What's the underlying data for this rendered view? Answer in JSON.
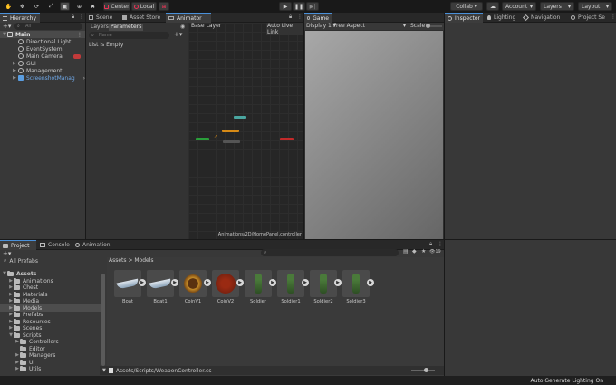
{
  "toolbar": {
    "pivot_label": "Center",
    "space_label": "Local",
    "collab_label": "Collab",
    "account_label": "Account",
    "layers_label": "Layers",
    "layout_label": "Layout"
  },
  "hierarchy": {
    "tab_label": "Hierarchy",
    "search_placeholder": "All",
    "scene_name": "Main",
    "items": [
      {
        "label": "Directional Light"
      },
      {
        "label": "EventSystem"
      },
      {
        "label": "Main Camera"
      },
      {
        "label": "GUI"
      },
      {
        "label": "Management"
      },
      {
        "label": "ScreenshotManag"
      }
    ]
  },
  "scene_tabs": {
    "scene": "Scene",
    "asset_store": "Asset Store",
    "animator": "Animator"
  },
  "animator": {
    "layers_tab": "Layers",
    "parameters_tab": "Parameters",
    "search_placeholder": "Name",
    "list_empty": "List is Empty",
    "base_layer": "Base Layer",
    "auto_live_link": "Auto Live Link",
    "footer_path": "Animations/2D/HomePanel.controller"
  },
  "game": {
    "tab_label": "Game",
    "display": "Display 1",
    "aspect": "Free Aspect",
    "scale_label": "Scale"
  },
  "inspector": {
    "tabs": [
      "Inspector",
      "Lighting",
      "Navigation",
      "Project Se"
    ]
  },
  "bottom_tabs": {
    "project": "Project",
    "console": "Console",
    "animation": "Animation"
  },
  "project": {
    "favorites": "All Prefabs",
    "root": "Assets",
    "folders": [
      {
        "label": "Animations"
      },
      {
        "label": "Chest"
      },
      {
        "label": "Materials"
      },
      {
        "label": "Media"
      },
      {
        "label": "Models"
      },
      {
        "label": "Prefabs"
      },
      {
        "label": "Resources"
      },
      {
        "label": "Scenes"
      },
      {
        "label": "Scripts"
      },
      {
        "label": "Controllers"
      },
      {
        "label": "Editor"
      },
      {
        "label": "Managers"
      },
      {
        "label": "Ui"
      },
      {
        "label": "Utils"
      }
    ],
    "breadcrumb_root": "Assets",
    "breadcrumb_current": "Models",
    "visible_count": "19",
    "assets": [
      {
        "label": "Boat"
      },
      {
        "label": "Boat1"
      },
      {
        "label": "CoinV1"
      },
      {
        "label": "CoinV2"
      },
      {
        "label": "Soldier"
      },
      {
        "label": "Soldier1"
      },
      {
        "label": "Soldier2"
      },
      {
        "label": "Soldier3"
      }
    ],
    "selected_path": "Assets/Scripts/WeaponController.cs"
  },
  "status_bar": {
    "text": "Auto Generate Lighting On"
  },
  "colors": {
    "accent": "#4a90d9",
    "node_entry": "#2a9e3a",
    "node_exit": "#c22a2a",
    "node_default": "#d68a16",
    "node_any": "#4aa6a0"
  }
}
